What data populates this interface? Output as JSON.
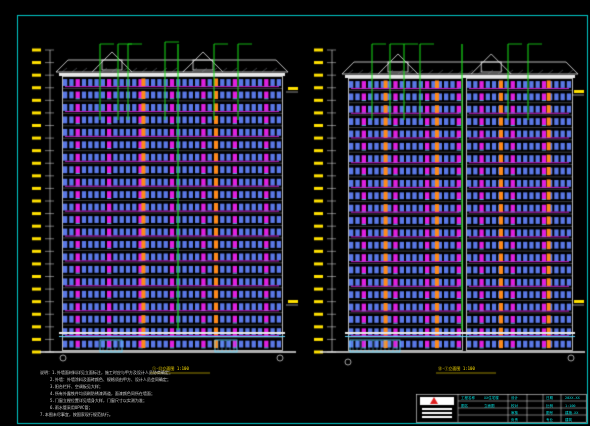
{
  "drawing": {
    "background": "#000000",
    "frame_color": "#00c8c8",
    "colors": {
      "window_blue": "#5a78e6",
      "balcony_magenta": "#e020e0",
      "orange_column": "#ff8a1a",
      "leader_green": "#18e018",
      "outline_white": "#e8e8e8",
      "cyan_grid": "#5fd6ff",
      "yellow_text": "#ffe000",
      "gray_wall": "#9aa0a8"
    }
  },
  "elevations": [
    {
      "id": "left",
      "caption": "①-⑬立面图 1:100"
    },
    {
      "id": "right",
      "caption": "⑬-①立面图 1:100"
    }
  ],
  "notes": [
    "说明：1.外墙面材料详见立面标注，施工时应与甲方及设计人员协商确定；",
    "2.外墙：外墙涂料及面砖颜色、规格须由甲方、设计人员会同确定；",
    "3.阳台栏杆、空调板见大样；",
    "4.所有外露铁件均须刷防锈漆两道，面漆颜色同所在墙面；",
    "5.门窗立樘位置详见墙身大样，门窗尺寸以实测为准；",
    "6.雨水管采用UPVC管；",
    "7.本图未尽事宜，按国家现行规范执行。"
  ],
  "title_block": {
    "logo": "logo-mark",
    "rows": [
      [
        "工程名称",
        "XX住宅楼",
        "设计",
        "",
        "日期",
        "20XX.XX"
      ],
      [
        "图名",
        "立面图",
        "校对",
        "",
        "比例",
        "1:100"
      ],
      [
        "",
        "",
        "审核",
        "",
        "图号",
        "建施-XX"
      ],
      [
        "",
        "",
        "负责",
        "",
        "专业",
        "建筑"
      ]
    ]
  }
}
